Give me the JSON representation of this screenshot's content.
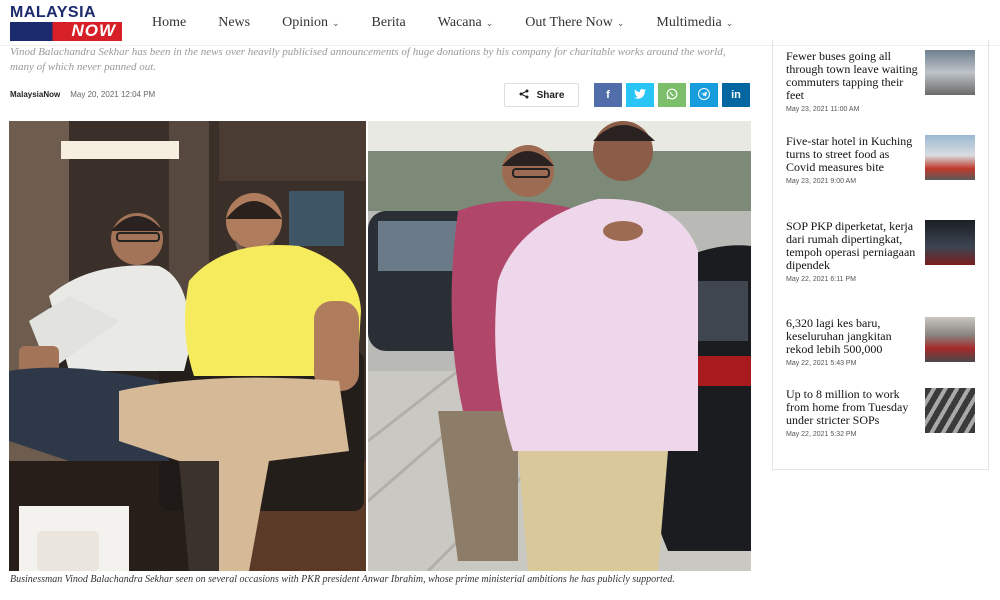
{
  "brand": {
    "line1": "MALAYSIA",
    "line2": "NOW"
  },
  "nav": [
    "Home",
    "News",
    "Opinion",
    "Berita",
    "Wacana",
    "Out There Now",
    "Multimedia"
  ],
  "article": {
    "subtitle": "Vinod Balachandra Sekhar has been in the news over heavily publicised announcements of huge donations by his company for charitable works around the world, many of which never panned out.",
    "author": "MalaysiaNow",
    "date": "May 20, 2021 12:04 PM",
    "share_label": "Share",
    "caption": "Businessman Vinod Balachandra Sekhar seen on several occasions with PKR president Anwar Ibrahim, whose prime ministerial ambitions he has publicly supported."
  },
  "sidebar": [
    {
      "title": "Fewer buses going all through town leave waiting commuters tapping their feet",
      "date": "May 23, 2021 11:00 AM"
    },
    {
      "title": "Five-star hotel in Kuching turns to street food as Covid measures bite",
      "date": "May 23, 2021 9:00 AM"
    },
    {
      "title": "SOP PKP diperketat, kerja dari rumah dipertingkat, tempoh operasi perniagaan dipendek",
      "date": "May 22, 2021 6:11 PM"
    },
    {
      "title": "6,320 lagi kes baru, keseluruhan jangkitan rekod lebih 500,000",
      "date": "May 22, 2021 5:43 PM"
    },
    {
      "title": "Up to 8 million to work from home from Tuesday under stricter SOPs",
      "date": "May 22, 2021 5:32 PM"
    }
  ],
  "icons": {
    "share": "share-icon",
    "facebook": "f",
    "twitter": "twitter-icon",
    "whatsapp": "whatsapp-icon",
    "telegram": "telegram-icon",
    "linkedin": "in"
  },
  "colors": {
    "brand_blue": "#1a2a6c",
    "brand_red": "#d61f26",
    "facebook": "#516eab",
    "twitter": "#29c5f6",
    "whatsapp": "#7bbf6a",
    "telegram": "#179cde",
    "linkedin": "#0266a0"
  }
}
